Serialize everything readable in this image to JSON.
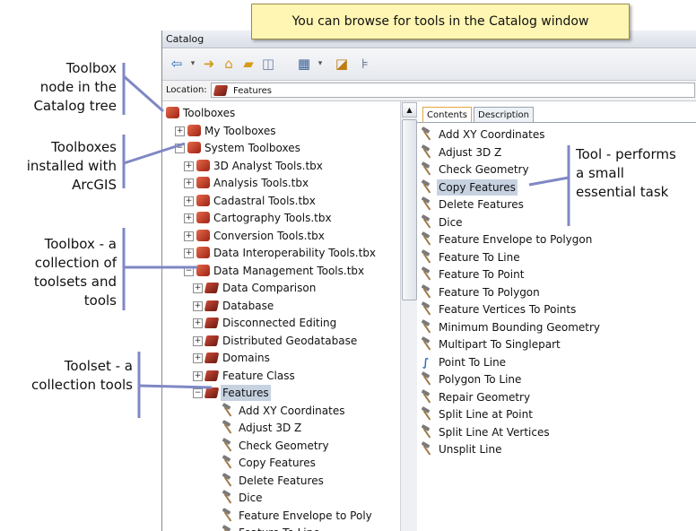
{
  "callout": "You can browse for tools in the Catalog window",
  "window": {
    "title": "Catalog"
  },
  "location": {
    "label": "Location:",
    "value": "Features"
  },
  "toolbar_icons": [
    "back-arrow-icon",
    "forward-arrow-icon",
    "home-icon",
    "home-folder-icon",
    "connect-folder-icon",
    "view-options-icon",
    "toggle-contents-icon",
    "tree-icon"
  ],
  "tree": [
    {
      "label": "Toolboxes",
      "level": 0,
      "icon": "toolbox",
      "expander": "none"
    },
    {
      "label": "My Toolboxes",
      "level": 1,
      "icon": "toolbox",
      "expander": "+"
    },
    {
      "label": "System Toolboxes",
      "level": 1,
      "icon": "toolbox",
      "expander": "-"
    },
    {
      "label": "3D Analyst Tools.tbx",
      "level": 2,
      "icon": "toolbox",
      "expander": "+"
    },
    {
      "label": "Analysis Tools.tbx",
      "level": 2,
      "icon": "toolbox",
      "expander": "+"
    },
    {
      "label": "Cadastral Tools.tbx",
      "level": 2,
      "icon": "toolbox",
      "expander": "+"
    },
    {
      "label": "Cartography Tools.tbx",
      "level": 2,
      "icon": "toolbox",
      "expander": "+"
    },
    {
      "label": "Conversion Tools.tbx",
      "level": 2,
      "icon": "toolbox",
      "expander": "+"
    },
    {
      "label": "Data Interoperability Tools.tbx",
      "level": 2,
      "icon": "toolbox",
      "expander": "+"
    },
    {
      "label": "Data Management Tools.tbx",
      "level": 2,
      "icon": "toolbox",
      "expander": "-"
    },
    {
      "label": "Data Comparison",
      "level": 3,
      "icon": "toolset",
      "expander": "+"
    },
    {
      "label": "Database",
      "level": 3,
      "icon": "toolset",
      "expander": "+"
    },
    {
      "label": "Disconnected Editing",
      "level": 3,
      "icon": "toolset",
      "expander": "+"
    },
    {
      "label": "Distributed Geodatabase",
      "level": 3,
      "icon": "toolset",
      "expander": "+"
    },
    {
      "label": "Domains",
      "level": 3,
      "icon": "toolset",
      "expander": "+"
    },
    {
      "label": "Feature Class",
      "level": 3,
      "icon": "toolset",
      "expander": "+"
    },
    {
      "label": "Features",
      "level": 3,
      "icon": "toolset",
      "expander": "-",
      "selected": true
    },
    {
      "label": "Add XY Coordinates",
      "level": 4,
      "icon": "tool",
      "expander": "none"
    },
    {
      "label": "Adjust 3D Z",
      "level": 4,
      "icon": "tool",
      "expander": "none"
    },
    {
      "label": "Check Geometry",
      "level": 4,
      "icon": "tool",
      "expander": "none"
    },
    {
      "label": "Copy Features",
      "level": 4,
      "icon": "tool",
      "expander": "none"
    },
    {
      "label": "Delete Features",
      "level": 4,
      "icon": "tool",
      "expander": "none"
    },
    {
      "label": "Dice",
      "level": 4,
      "icon": "tool",
      "expander": "none"
    },
    {
      "label": "Feature Envelope to Poly",
      "level": 4,
      "icon": "tool",
      "expander": "none"
    },
    {
      "label": "Feature To Line",
      "level": 4,
      "icon": "tool",
      "expander": "none"
    }
  ],
  "tabs": [
    {
      "label": "Contents",
      "active": true
    },
    {
      "label": "Description",
      "active": false
    }
  ],
  "contents": [
    {
      "label": "Add XY Coordinates",
      "icon": "tool"
    },
    {
      "label": "Adjust 3D Z",
      "icon": "tool"
    },
    {
      "label": "Check Geometry",
      "icon": "tool"
    },
    {
      "label": "Copy Features",
      "icon": "tool",
      "selected": true
    },
    {
      "label": "Delete Features",
      "icon": "tool"
    },
    {
      "label": "Dice",
      "icon": "tool"
    },
    {
      "label": "Feature Envelope to Polygon",
      "icon": "tool"
    },
    {
      "label": "Feature To Line",
      "icon": "tool"
    },
    {
      "label": "Feature To Point",
      "icon": "tool"
    },
    {
      "label": "Feature To Polygon",
      "icon": "tool"
    },
    {
      "label": "Feature Vertices To Points",
      "icon": "tool"
    },
    {
      "label": "Minimum Bounding Geometry",
      "icon": "tool"
    },
    {
      "label": "Multipart To Singlepart",
      "icon": "tool"
    },
    {
      "label": "Point To Line",
      "icon": "script"
    },
    {
      "label": "Polygon To Line",
      "icon": "tool"
    },
    {
      "label": "Repair Geometry",
      "icon": "tool"
    },
    {
      "label": "Split Line at Point",
      "icon": "tool"
    },
    {
      "label": "Split Line At Vertices",
      "icon": "tool"
    },
    {
      "label": "Unsplit Line",
      "icon": "tool"
    }
  ],
  "annotations": [
    {
      "name": "toolbox-node",
      "lines": [
        "Toolbox",
        "node in the",
        "Catalog tree"
      ]
    },
    {
      "name": "system-toolboxes",
      "lines": [
        "Toolboxes",
        "installed with",
        "ArcGIS"
      ]
    },
    {
      "name": "toolbox-def",
      "lines": [
        "Toolbox - a",
        "collection of",
        "toolsets and",
        "tools"
      ]
    },
    {
      "name": "toolset-def",
      "lines": [
        "Toolset - a",
        "collection tools"
      ]
    },
    {
      "name": "tool-def",
      "lines": [
        "Tool - performs",
        "a small",
        "essential task"
      ]
    }
  ],
  "colors": {
    "accent": "#7f88c4",
    "callout": "#fff6b3",
    "selection": "#c7d2e1"
  }
}
